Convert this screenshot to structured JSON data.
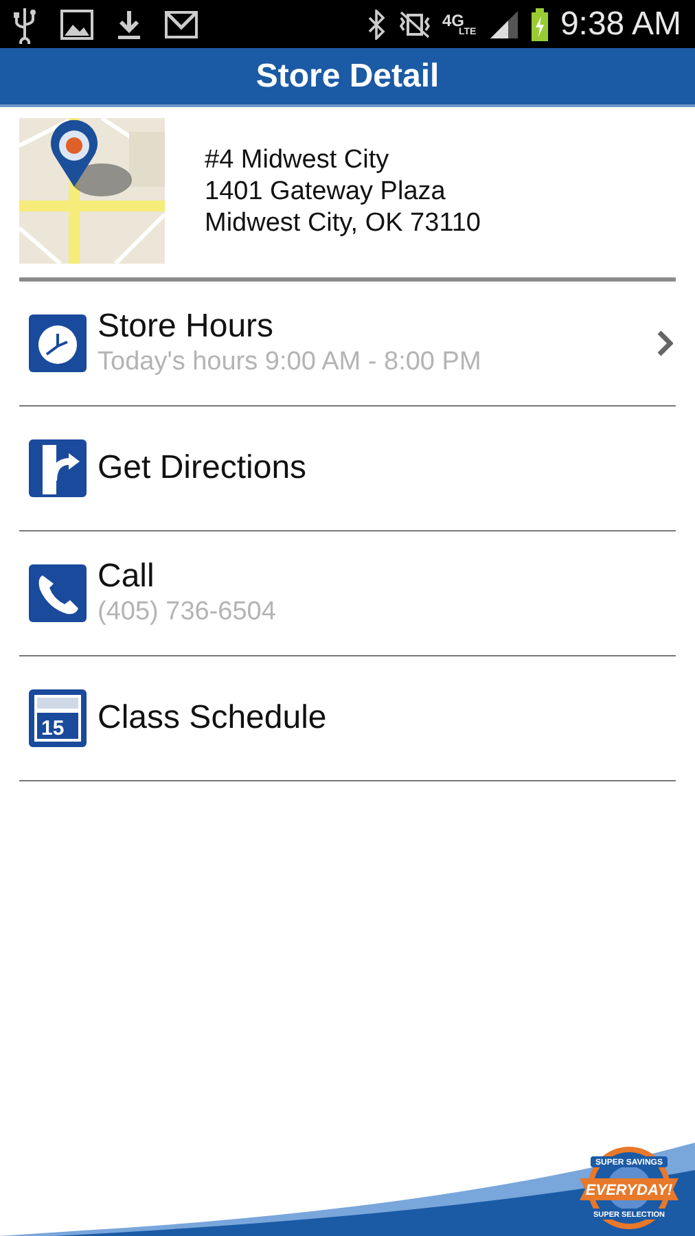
{
  "status_bar": {
    "network": "4G",
    "network_sub": "LTE",
    "time": "9:38 AM"
  },
  "title": "Store Detail",
  "store": {
    "address": [
      "#4 Midwest City",
      "1401 Gateway Plaza",
      "Midwest City, OK 73110"
    ]
  },
  "items": [
    {
      "kind": "clock",
      "title": "Store Hours",
      "subtitle": "Today's hours 9:00 AM - 8:00 PM",
      "chevron": true
    },
    {
      "kind": "directions",
      "title": "Get Directions",
      "chevron": false
    },
    {
      "kind": "phone",
      "title": "Call",
      "subtitle": "(405) 736-6504",
      "chevron": false
    },
    {
      "kind": "calendar",
      "icon_text": "15",
      "title": "Class Schedule",
      "chevron": false
    }
  ],
  "badge": {
    "top": "SUPER SAVINGS",
    "main": "EVERYDAY!",
    "bottom": "SUPER SELECTION"
  }
}
